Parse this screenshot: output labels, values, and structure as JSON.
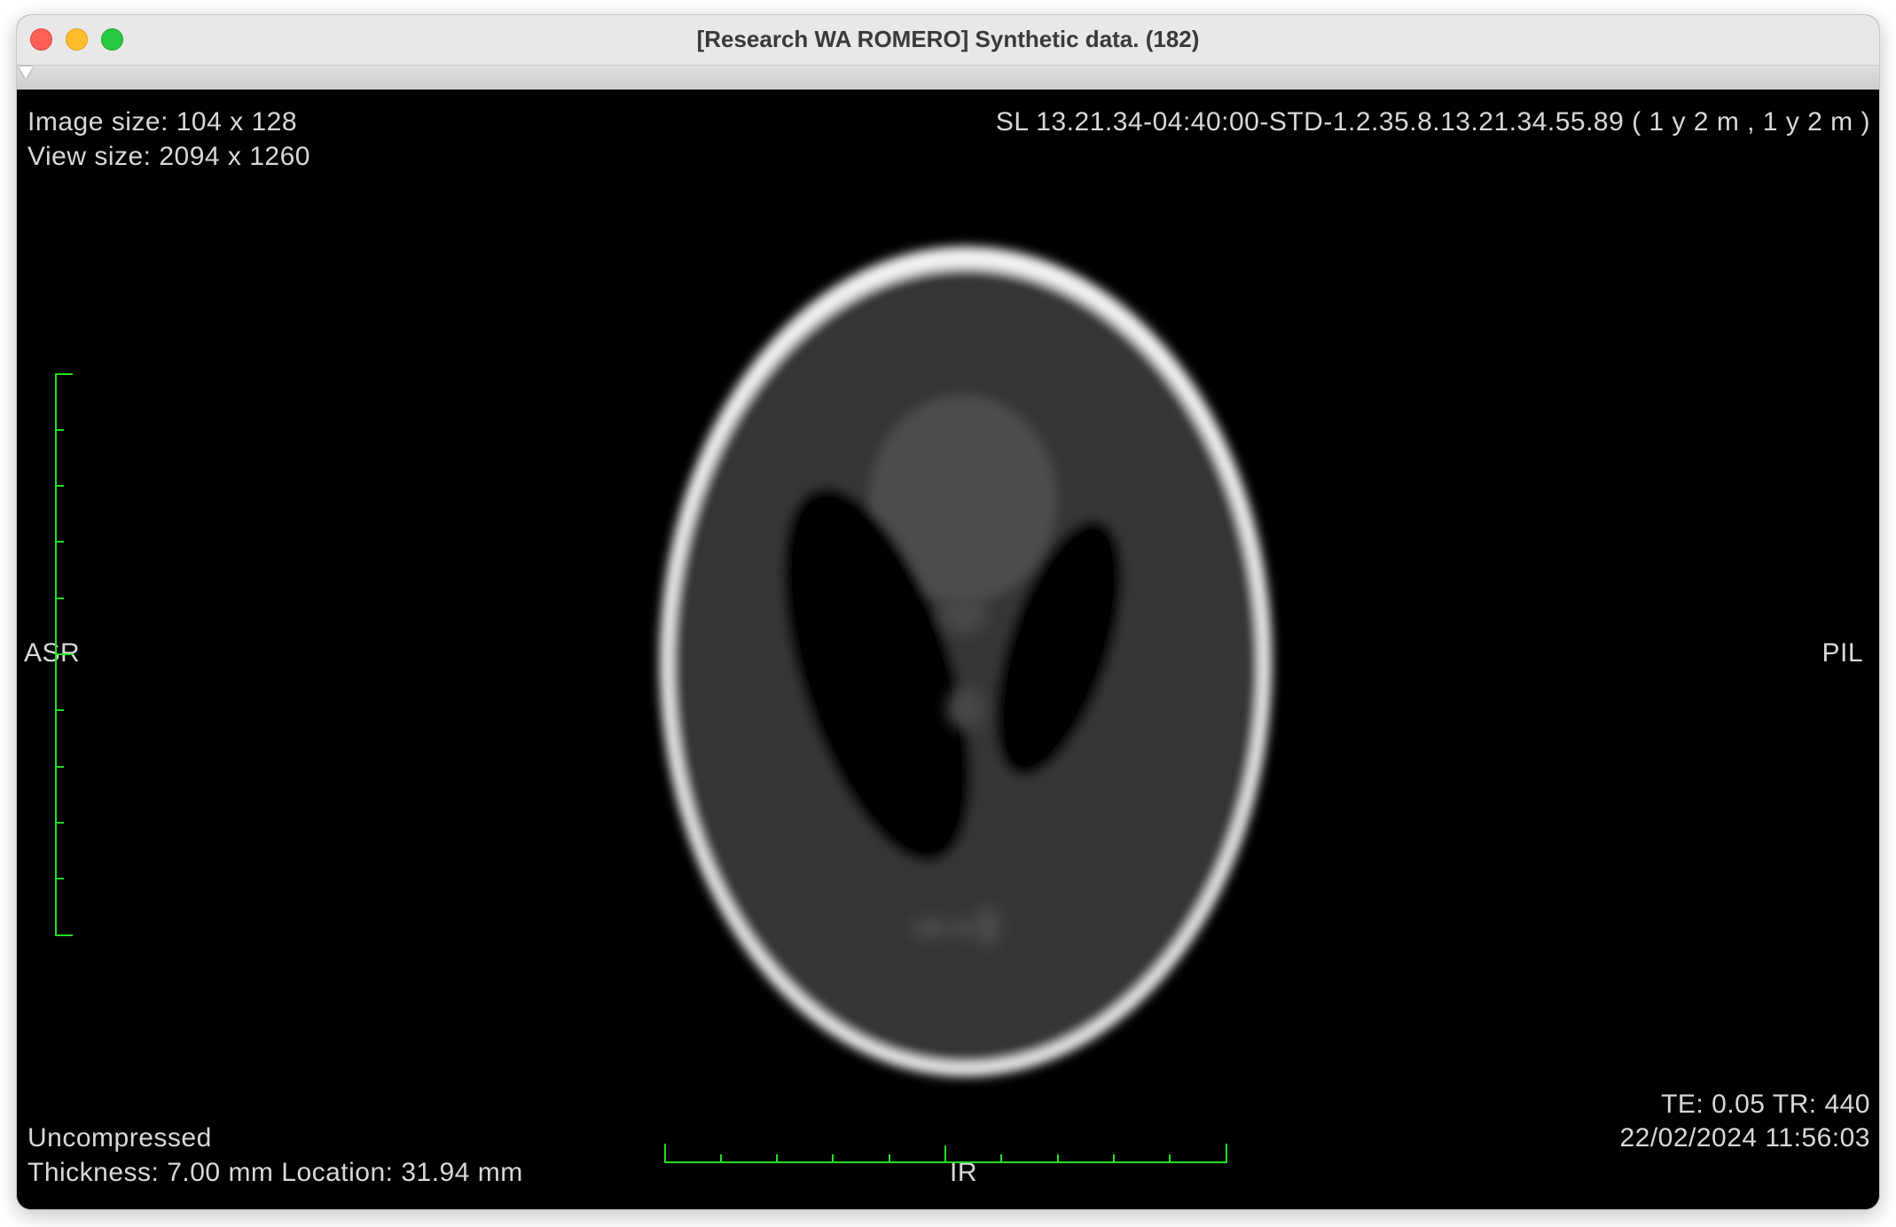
{
  "window": {
    "title": "[Research WA ROMERO] Synthetic data. (182)"
  },
  "overlay": {
    "image_size": "Image size: 104 x 128",
    "view_size": "View size: 2094 x 1260",
    "series_info": "SL  13.21.34-04:40:00-STD-1.2.35.8.13.21.34.55.89 ( 1 y 2 m , 1 y 2 m )",
    "orientation_left": "ASR",
    "orientation_right": "PIL",
    "orientation_bottom": "IR",
    "compression": "Uncompressed",
    "thickness_location": "Thickness: 7.00 mm Location: 31.94 mm",
    "te_tr": "TE:  0.05 TR:  440",
    "datetime": "22/02/2024 11:56:03"
  },
  "colors": {
    "scale_bar": "#22dd22",
    "overlay_text": "#d8d8d8",
    "background": "#000000"
  },
  "icons": {
    "close": "close-button-icon",
    "minimize": "minimize-button-icon",
    "maximize": "maximize-button-icon",
    "slider": "slider-thumb-icon"
  }
}
